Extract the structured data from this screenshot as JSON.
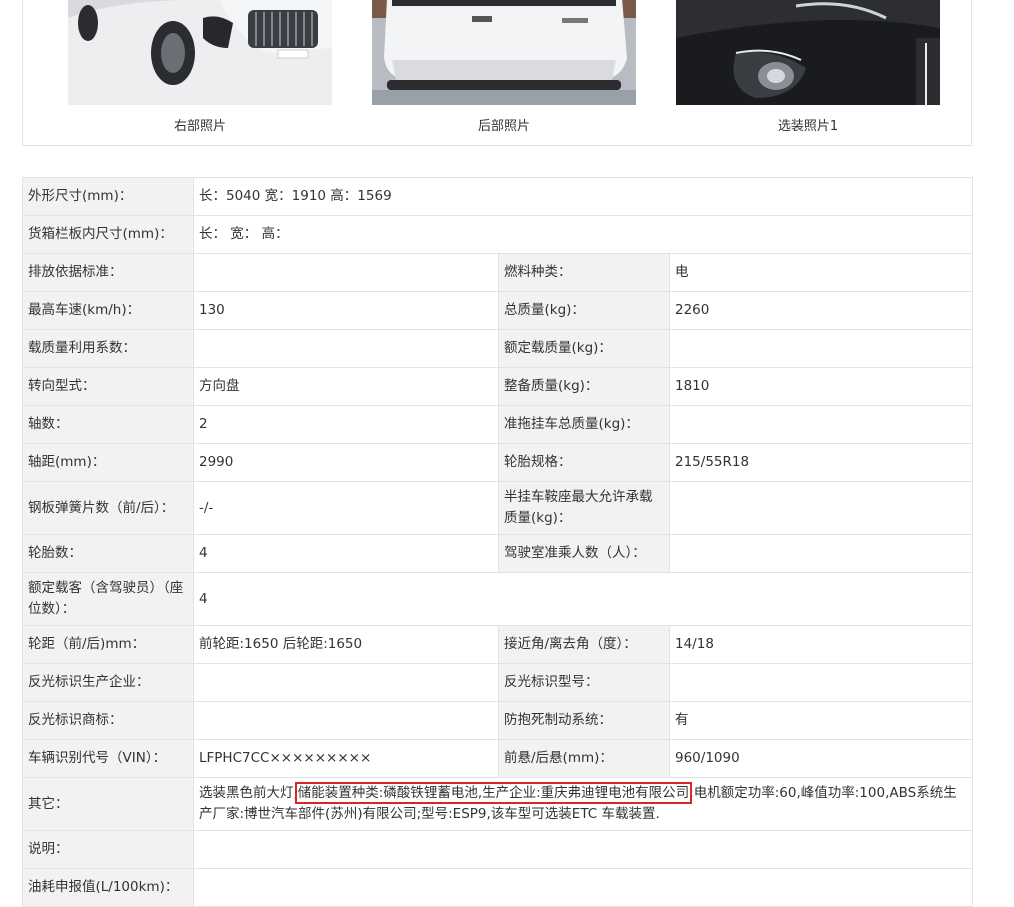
{
  "photos": [
    {
      "caption": "右部照片",
      "icon": "car-front-right-photo"
    },
    {
      "caption": "后部照片",
      "icon": "car-rear-photo"
    },
    {
      "caption": "选装照片1",
      "icon": "car-headlight-photo"
    }
  ],
  "specs": {
    "r1": {
      "label": "外形尺寸(mm)：",
      "value": "长：5040 宽：1910 高：1569"
    },
    "r2": {
      "label": "货箱栏板内尺寸(mm)：",
      "value": "长： 宽： 高："
    },
    "r3": {
      "l1": "排放依据标准：",
      "v1": "",
      "l2": "燃料种类：",
      "v2": "电"
    },
    "r4": {
      "l1": "最高车速(km/h)：",
      "v1": "130",
      "l2": "总质量(kg)：",
      "v2": "2260"
    },
    "r5": {
      "l1": "载质量利用系数：",
      "v1": "",
      "l2": "额定载质量(kg)：",
      "v2": ""
    },
    "r6": {
      "l1": "转向型式：",
      "v1": "方向盘",
      "l2": "整备质量(kg)：",
      "v2": "1810"
    },
    "r7": {
      "l1": "轴数：",
      "v1": "2",
      "l2": "准拖挂车总质量(kg)：",
      "v2": ""
    },
    "r8": {
      "l1": "轴距(mm)：",
      "v1": "2990",
      "l2": "轮胎规格：",
      "v2": "215/55R18"
    },
    "r9": {
      "l1": "钢板弹簧片数（前/后）：",
      "v1": "-/-",
      "l2": "半挂车鞍座最大允许承载质量(kg)：",
      "v2": ""
    },
    "r10": {
      "l1": "轮胎数：",
      "v1": "4",
      "l2": "驾驶室准乘人数（人）：",
      "v2": ""
    },
    "r11": {
      "label": "额定载客（含驾驶员）（座位数）：",
      "value": "4"
    },
    "r12": {
      "l1": "轮距（前/后)mm：",
      "v1": "前轮距:1650 后轮距:1650",
      "l2": "接近角/离去角（度）：",
      "v2": "14/18"
    },
    "r13": {
      "l1": "反光标识生产企业：",
      "v1": "",
      "l2": "反光标识型号：",
      "v2": ""
    },
    "r14": {
      "l1": "反光标识商标：",
      "v1": "",
      "l2": "防抱死制动系统：",
      "v2": "有"
    },
    "r15": {
      "l1": "车辆识别代号（VIN）：",
      "v1": "LFPHC7CC×××××××××",
      "l2": "前悬/后悬(mm)：",
      "v2": "960/1090"
    },
    "r16": {
      "label": "其它：",
      "pre": "选装黑色前大灯,",
      "highlight": "储能装置种类:磷酸铁锂蓄电池,生产企业:重庆弗迪锂电池有限公司",
      "post": ";电机额定功率:60,峰值功率:100,ABS系统生产厂家:博世汽车部件(苏州)有限公司;型号:ESP9,该车型可选装ETC 车载装置."
    },
    "r17": {
      "label": "说明：",
      "value": ""
    },
    "r18": {
      "label": "油耗申报值(L/100km)：",
      "value": ""
    }
  },
  "colors": {
    "label_bg": "#f2f2f2",
    "border": "#e3e3e3",
    "highlight": "#d9262a"
  }
}
